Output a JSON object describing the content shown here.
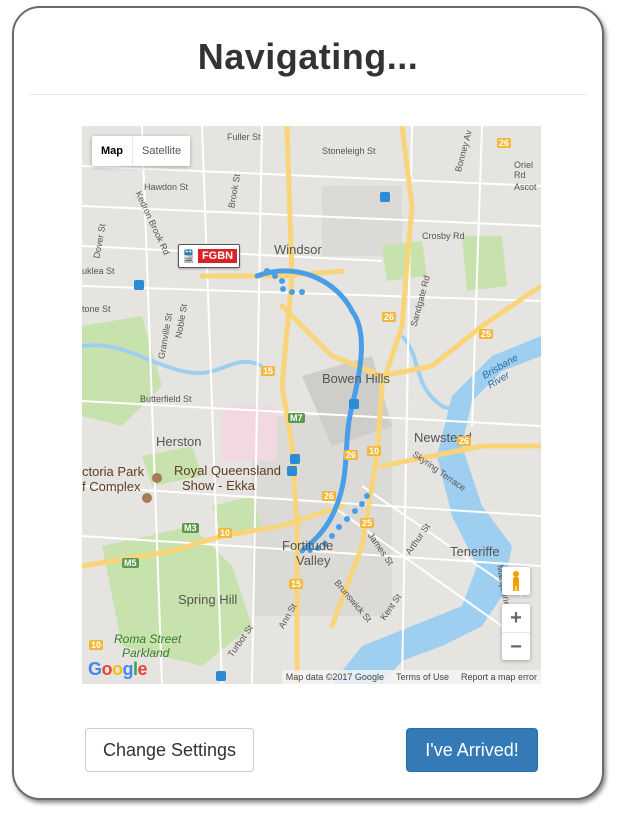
{
  "header": {
    "title": "Navigating..."
  },
  "map": {
    "type_control": {
      "map": "Map",
      "satellite": "Satellite"
    },
    "station_label": "FGBN",
    "attribution": {
      "data": "Map data ©2017 Google",
      "terms": "Terms of Use",
      "report": "Report a map error"
    },
    "logo": "Google",
    "zoom_in": "+",
    "zoom_out": "−",
    "places": [
      {
        "text": "Windsor"
      },
      {
        "text": "Bowen Hills"
      },
      {
        "text": "Herston"
      },
      {
        "text": "Newstead"
      },
      {
        "text": "Royal Queensland"
      },
      {
        "text": "Show - Ekka"
      },
      {
        "text": "ctoria Park"
      },
      {
        "text": "f Complex"
      },
      {
        "text": "Fortitude"
      },
      {
        "text": "Valley"
      },
      {
        "text": "Teneriffe"
      },
      {
        "text": "Spring Hill"
      },
      {
        "text": "Roma Street"
      },
      {
        "text": "Parkland"
      },
      {
        "text": "Brisbane River"
      }
    ],
    "streets": [
      {
        "text": "Fuller St"
      },
      {
        "text": "Stoneleigh St"
      },
      {
        "text": "Hawdon St"
      },
      {
        "text": "Kedron Brook Rd"
      },
      {
        "text": "Dover St"
      },
      {
        "text": "Brook St"
      },
      {
        "text": "Crosby Rd"
      },
      {
        "text": "Sandgate Rd"
      },
      {
        "text": "uklea St"
      },
      {
        "text": "tone St"
      },
      {
        "text": "Granville St"
      },
      {
        "text": "Noble St"
      },
      {
        "text": "Butterfield St"
      },
      {
        "text": "Skyring Terrace"
      },
      {
        "text": "James St"
      },
      {
        "text": "Arthur St"
      },
      {
        "text": "Brunswick St"
      },
      {
        "text": "Kent St"
      },
      {
        "text": "Ann St"
      },
      {
        "text": "Turbot St"
      },
      {
        "text": "Macquarie St"
      },
      {
        "text": "Bonney Av"
      },
      {
        "text": "Oriel Rd"
      },
      {
        "text": "Ascot"
      }
    ],
    "shields": [
      {
        "text": "26"
      },
      {
        "text": "26"
      },
      {
        "text": "25"
      },
      {
        "text": "15"
      },
      {
        "text": "M7"
      },
      {
        "text": "26"
      },
      {
        "text": "10"
      },
      {
        "text": "26"
      },
      {
        "text": "25"
      },
      {
        "text": "M3"
      },
      {
        "text": "10"
      },
      {
        "text": "M5"
      },
      {
        "text": "15"
      },
      {
        "text": "10"
      },
      {
        "text": "26"
      }
    ]
  },
  "actions": {
    "change_settings": "Change Settings",
    "arrived": "I've Arrived!"
  },
  "colors": {
    "primary": "#337ab7",
    "route": "#4a9ee8",
    "water": "#9fcff0",
    "park": "#c8e2ad",
    "road": "#f9d57a",
    "station_code_bg": "#d8232a"
  }
}
